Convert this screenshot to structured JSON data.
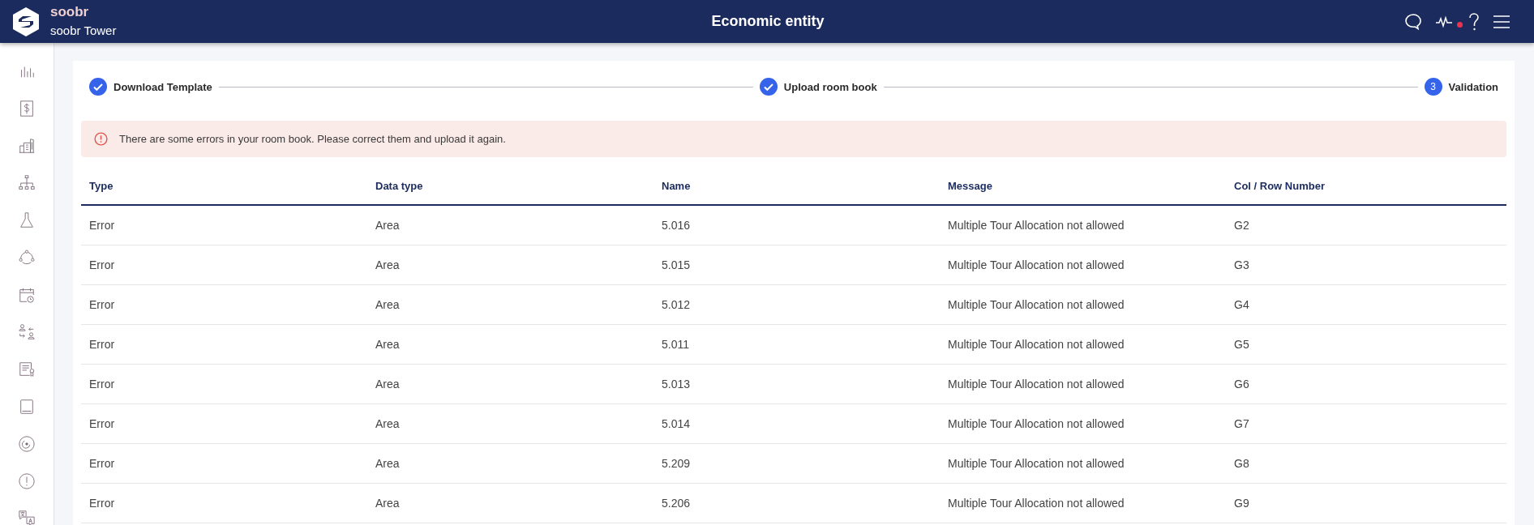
{
  "header": {
    "brand": "soobr",
    "site": "soobr Tower",
    "title": "Economic entity",
    "notification_dot": true
  },
  "sidebar": {
    "items": [
      {
        "kind": "chart",
        "selected": false
      },
      {
        "kind": "dollar",
        "selected": false
      },
      {
        "kind": "buildings",
        "selected": false
      },
      {
        "kind": "hierarchy",
        "selected": false
      },
      {
        "kind": "flask",
        "selected": false
      },
      {
        "kind": "cycle",
        "selected": false
      },
      {
        "kind": "calendar",
        "selected": false
      },
      {
        "kind": "swap",
        "selected": false
      },
      {
        "kind": "certificate",
        "selected": false
      },
      {
        "kind": "book",
        "selected": false
      },
      {
        "kind": "target",
        "selected": false
      },
      {
        "kind": "alert",
        "selected": false
      },
      {
        "kind": "translate",
        "selected": false
      }
    ]
  },
  "stepper": {
    "steps": [
      {
        "label": "Download Template",
        "done": true
      },
      {
        "label": "Upload room book",
        "done": true
      },
      {
        "label": "Validation",
        "number": "3",
        "done": false
      }
    ]
  },
  "alert": {
    "message": "There are some errors in your room book. Please correct them and upload it again."
  },
  "table": {
    "columns": [
      "Type",
      "Data type",
      "Name",
      "Message",
      "Col / Row Number"
    ],
    "rows": [
      [
        "Error",
        "Area",
        "5.016",
        "Multiple Tour Allocation not allowed",
        "G2"
      ],
      [
        "Error",
        "Area",
        "5.015",
        "Multiple Tour Allocation not allowed",
        "G3"
      ],
      [
        "Error",
        "Area",
        "5.012",
        "Multiple Tour Allocation not allowed",
        "G4"
      ],
      [
        "Error",
        "Area",
        "5.011",
        "Multiple Tour Allocation not allowed",
        "G5"
      ],
      [
        "Error",
        "Area",
        "5.013",
        "Multiple Tour Allocation not allowed",
        "G6"
      ],
      [
        "Error",
        "Area",
        "5.014",
        "Multiple Tour Allocation not allowed",
        "G7"
      ],
      [
        "Error",
        "Area",
        "5.209",
        "Multiple Tour Allocation not allowed",
        "G8"
      ],
      [
        "Error",
        "Area",
        "5.206",
        "Multiple Tour Allocation not allowed",
        "G9"
      ]
    ]
  }
}
